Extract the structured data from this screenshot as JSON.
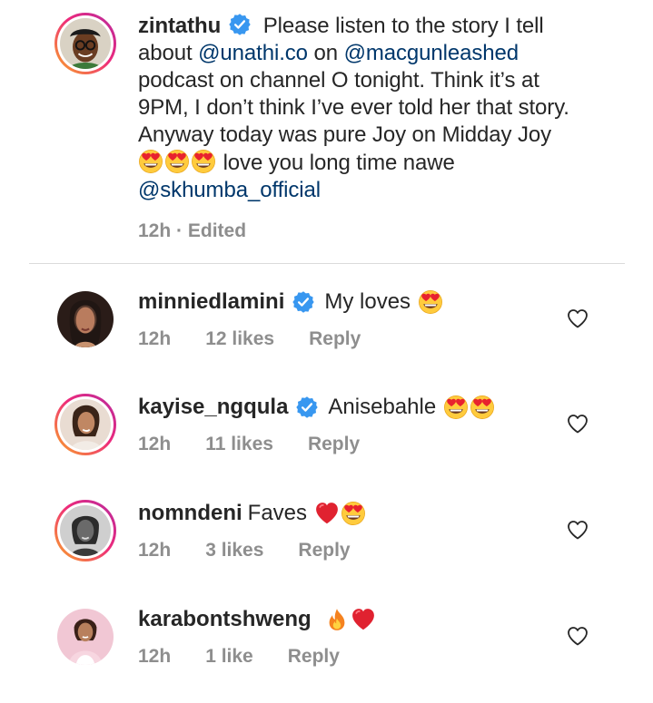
{
  "caption": {
    "username": "zintathu",
    "text_1": "Please listen to the story I tell about",
    "mention_1": "@unathi.co",
    "text_2": "on",
    "mention_2": "@macgunleashed",
    "text_3": "podcast on channel O tonight. Think it’s at 9PM, I don’t think I’ve ever told her that story. Anyway today was pure Joy on Midday Joy",
    "text_4": "love you long time nawe",
    "mention_3": "@skhumba_official",
    "time": "12h",
    "separator": "·",
    "edited": "Edited"
  },
  "comments": [
    {
      "username": "minniedlamini",
      "verified": true,
      "text": "My loves",
      "time": "12h",
      "likes": "12 likes",
      "reply": "Reply"
    },
    {
      "username": "kayise_ngqula",
      "verified": true,
      "text": "Anisebahle",
      "time": "12h",
      "likes": "11 likes",
      "reply": "Reply"
    },
    {
      "username": "nomndeni",
      "verified": false,
      "text": "Faves",
      "time": "12h",
      "likes": "3 likes",
      "reply": "Reply"
    },
    {
      "username": "karabontshweng",
      "verified": false,
      "text": "",
      "time": "12h",
      "likes": "1 like",
      "reply": "Reply"
    }
  ],
  "icons": {
    "verified": "verified-badge-icon",
    "like": "heart-outline-icon",
    "heart_eyes": "heart-eyes-emoji",
    "red_heart": "red-heart-emoji",
    "fire": "fire-emoji"
  },
  "colors": {
    "text": "#262626",
    "meta": "#8e8e8e",
    "mention": "#00376b",
    "verified": "#3897f0",
    "divider": "#dbdbdb",
    "story_ring_start": "#f9a826",
    "story_ring_end": "#b52ba0"
  }
}
